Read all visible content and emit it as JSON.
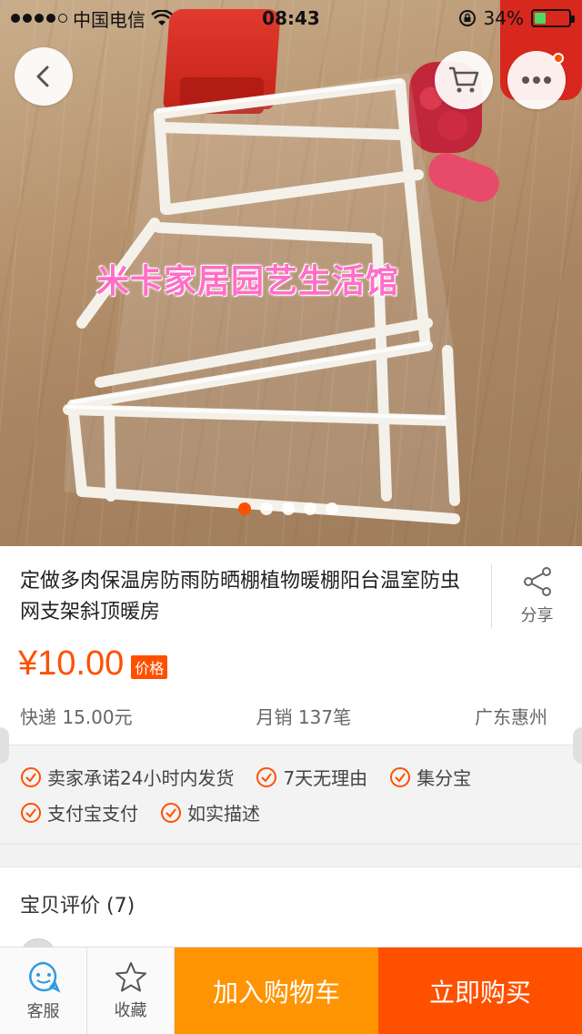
{
  "status_bar": {
    "carrier": "中国电信",
    "time": "08:43",
    "battery": "34%",
    "battery_level": 0.34
  },
  "hero": {
    "watermark": "米卡家居园艺生活馆",
    "pager_total": 5,
    "pager_active": 0,
    "icons": [
      "back-icon",
      "cart-icon",
      "more-icon"
    ]
  },
  "product": {
    "title": "定做多肉保温房防雨防晒棚植物暖棚阳台温室防虫网支架斜顶暖房",
    "share_label": "分享",
    "price": "¥10.00",
    "price_tag": "价格",
    "shipping": "快递 15.00元",
    "monthly_sales": "月销 137笔",
    "location": "广东惠州"
  },
  "guarantees": [
    "卖家承诺24小时内发货",
    "7天无理由",
    "集分宝",
    "支付宝支付",
    "如实描述"
  ],
  "reviews": {
    "title": "宝贝评价 (7)"
  },
  "bottom_bar": {
    "service_label": "客服",
    "favorite_label": "收藏",
    "add_cart_label": "加入购物车",
    "buy_now_label": "立即购买"
  },
  "colors": {
    "accent": "#ff5000",
    "cart_button": "#ff9402"
  }
}
